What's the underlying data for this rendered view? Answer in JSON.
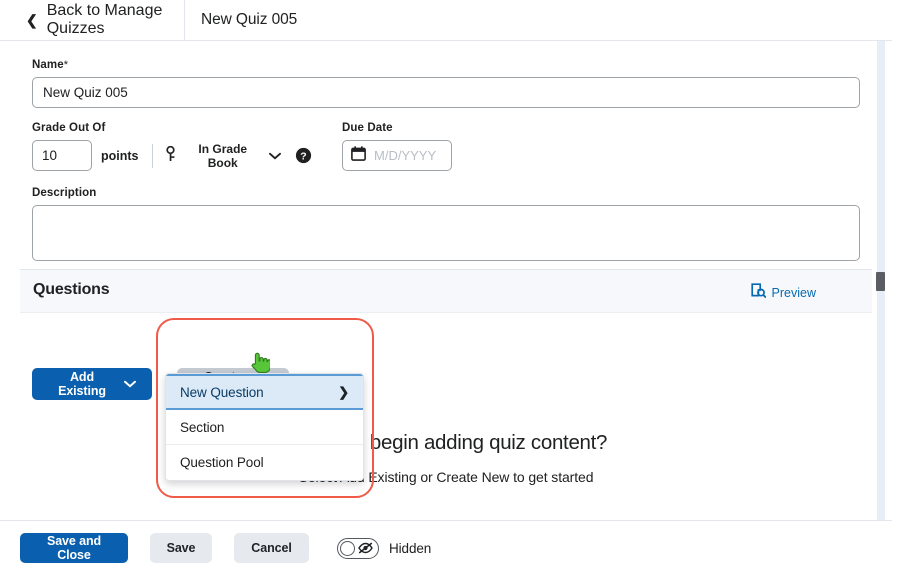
{
  "topbar": {
    "back_label": "Back to Manage Quizzes",
    "back_icon": "chevron-left-icon",
    "doc_title": "New Quiz 005"
  },
  "form": {
    "name": {
      "label": "Name",
      "required_mark": "*",
      "value": "New Quiz 005"
    },
    "grade_out_of": {
      "label": "Grade Out Of",
      "value": "10",
      "unit": "points",
      "gradebook_label": "In Grade Book",
      "gradebook_icon": "key-icon",
      "gradebook_caret": "chevron-down-icon",
      "help_icon": "help-circle-icon"
    },
    "due_date": {
      "label": "Due Date",
      "placeholder": "M/D/YYYY",
      "value": "",
      "icon": "calendar-icon"
    },
    "description": {
      "label": "Description",
      "value": ""
    }
  },
  "questions": {
    "title": "Questions",
    "preview_label": "Preview",
    "preview_icon": "preview-search-icon",
    "add_existing_label": "Add Existing",
    "add_existing_caret": "chevron-down-icon",
    "create_new_label": "Create New",
    "create_new_caret": "chevron-down-icon",
    "empty_title": "Ready to begin adding quiz content?",
    "empty_subtitle": "Select Add Existing or Create New to get started",
    "menu": [
      {
        "label": "New Question",
        "selected": true,
        "submenu_icon": "chevron-right-icon"
      },
      {
        "label": "Section",
        "selected": false,
        "submenu_icon": ""
      },
      {
        "label": "Question Pool",
        "selected": false,
        "submenu_icon": ""
      }
    ]
  },
  "footer": {
    "save_and_close_label": "Save and Close",
    "save_label": "Save",
    "cancel_label": "Cancel",
    "visibility_label": "Hidden",
    "visibility_icon": "eye-off-icon",
    "visibility_on": false
  },
  "annotation": {
    "shape": "rounded-rect-highlight"
  },
  "cursor": {
    "icon": "pointing-hand-cursor"
  },
  "colors": {
    "primary_blue": "#0a5fae",
    "link_blue": "#066ab1",
    "annotation_red": "#ef5b48",
    "menu_highlight": "#dceaf7",
    "band_bg": "#f7f8fb",
    "pressed_gray": "#c5cbd3"
  }
}
